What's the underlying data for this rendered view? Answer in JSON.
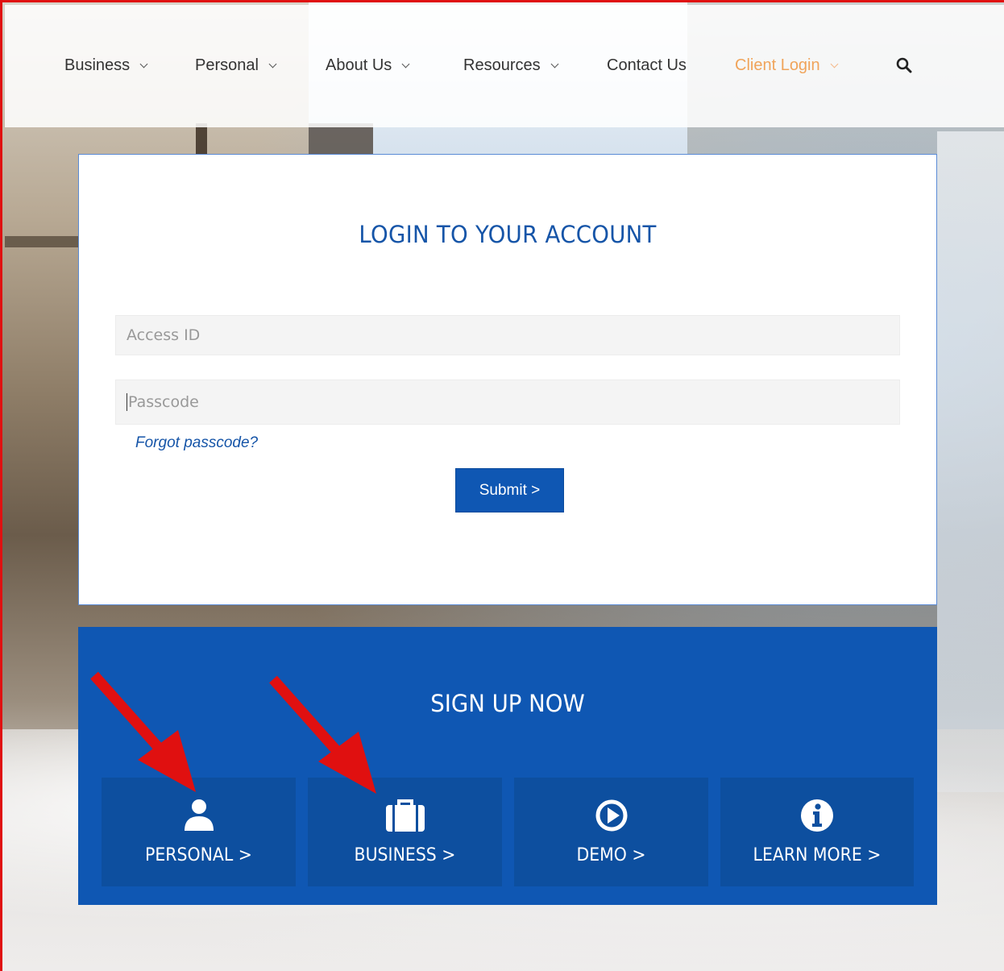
{
  "nav": {
    "items": [
      {
        "label": "Business",
        "has_dropdown": true
      },
      {
        "label": "Personal",
        "has_dropdown": true
      },
      {
        "label": "About Us",
        "has_dropdown": true
      },
      {
        "label": "Resources",
        "has_dropdown": true
      },
      {
        "label": "Contact Us",
        "has_dropdown": false
      },
      {
        "label": "Client Login",
        "has_dropdown": true,
        "active": true
      }
    ],
    "search_icon": "search-icon"
  },
  "login": {
    "title": "LOGIN TO YOUR ACCOUNT",
    "access_id_placeholder": "Access ID",
    "passcode_placeholder": "Passcode",
    "forgot_label": "Forgot passcode?",
    "submit_label": "Submit >"
  },
  "signup": {
    "title": "SIGN UP NOW",
    "tiles": [
      {
        "label": "PERSONAL >",
        "icon": "user-icon"
      },
      {
        "label": "BUSINESS >",
        "icon": "briefcase-icon"
      },
      {
        "label": "DEMO >",
        "icon": "play-circle-icon"
      },
      {
        "label": "LEARN MORE >",
        "icon": "info-circle-icon"
      }
    ]
  },
  "colors": {
    "brand_blue": "#0f57b3",
    "tile_blue": "#0d4f9f",
    "active_nav": "#f0a45a",
    "annotation_red": "#e01010"
  }
}
